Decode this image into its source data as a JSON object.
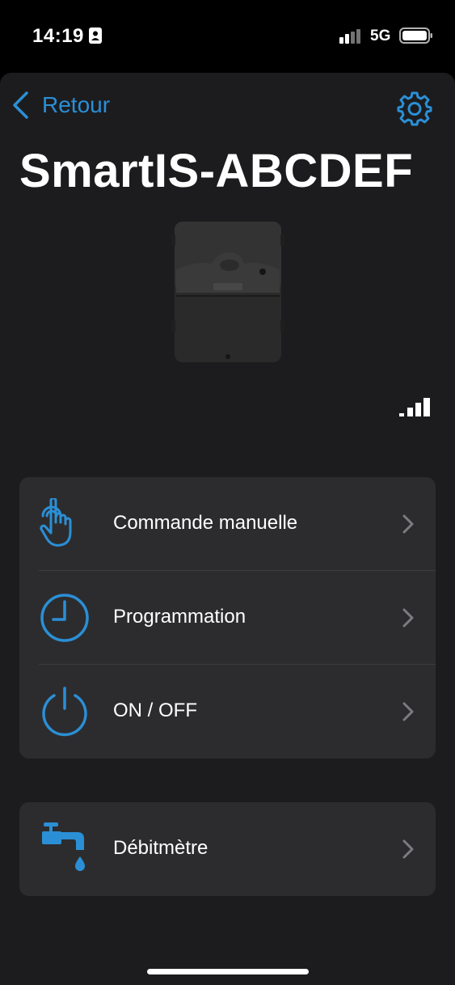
{
  "status_bar": {
    "time": "14:19",
    "network": "5G"
  },
  "nav": {
    "back_label": "Retour"
  },
  "device": {
    "name": "SmartIS-ABCDEF"
  },
  "menu": {
    "items": [
      {
        "label": "Commande manuelle",
        "icon": "hand-tap-icon"
      },
      {
        "label": "Programmation",
        "icon": "clock-icon"
      },
      {
        "label": "ON / OFF",
        "icon": "power-icon"
      }
    ]
  },
  "flow": {
    "label": "Débitmètre",
    "icon": "faucet-icon"
  },
  "colors": {
    "accent": "#2b8fd6",
    "background": "#1c1c1e",
    "card": "#2c2c2e"
  }
}
